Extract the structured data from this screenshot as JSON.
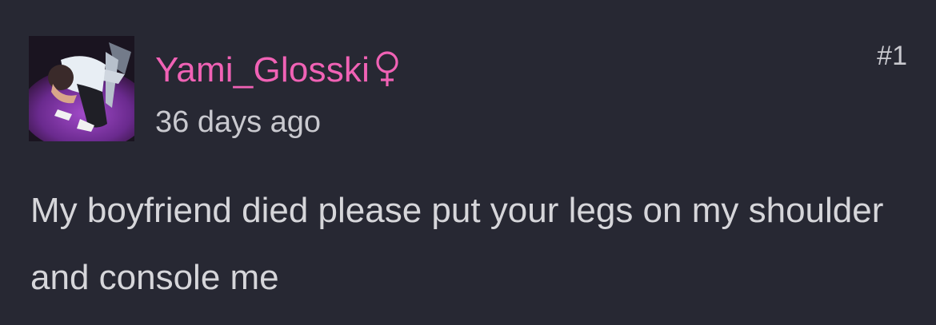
{
  "post": {
    "username": "Yami_Glosski",
    "gender_icon": "female-symbol-icon",
    "timestamp": "36 days ago",
    "post_number": "#1",
    "body": "My boyfriend died please put your legs on my shoulder and console me"
  },
  "colors": {
    "background": "#272833",
    "username": "#f062b5",
    "text": "#d6d6da",
    "muted": "#c9c9cf"
  }
}
